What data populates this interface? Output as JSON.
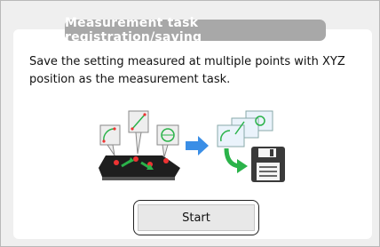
{
  "dialog": {
    "title": "Measurement task registration/saving",
    "description": "Save the setting measured at multiple points with XYZ position as the measurement task.",
    "start_label": "Start"
  },
  "icons": {
    "illustration": "measurement-task-save-illustration",
    "arrow": "right-arrow-icon",
    "disk": "floppy-disk-icon"
  },
  "colors": {
    "title_bg": "#a8a8a8",
    "arrow_blue": "#3a8ee6",
    "arrow_green": "#2bb34a",
    "disk": "#3a3a3a"
  }
}
